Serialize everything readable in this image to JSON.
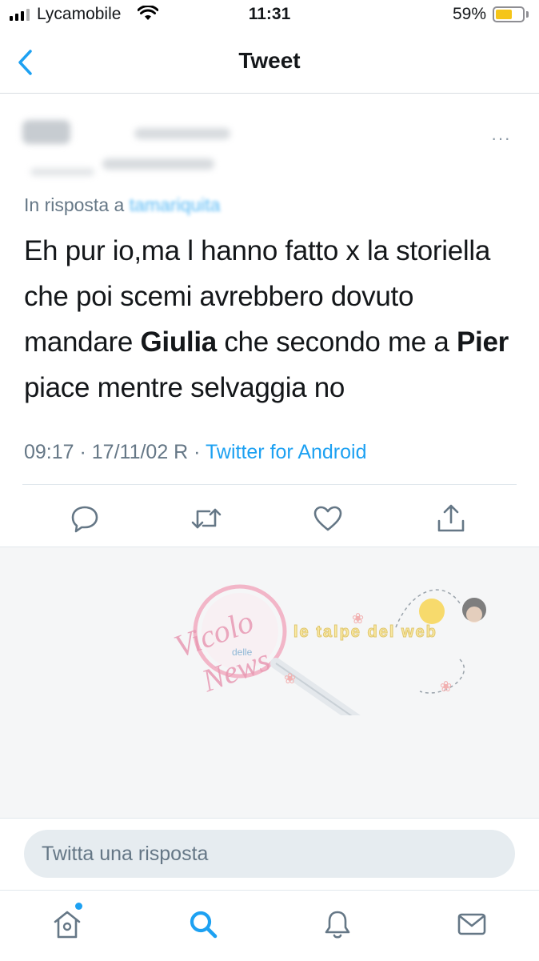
{
  "status_bar": {
    "carrier": "Lycamobile",
    "time": "11:31",
    "battery_percent": "59%",
    "battery_level": 0.59,
    "signal_bars": 4
  },
  "nav": {
    "title": "Tweet",
    "back_icon": "chevron-left-icon"
  },
  "tweet": {
    "more_label": "···",
    "reply_prefix": "In risposta a",
    "reply_handle": "tamariquita",
    "text_segments": [
      {
        "text": "Eh pur io,ma l hanno fatto x la storiella che poi scemi avrebbero dovuto mandare ",
        "bold": false
      },
      {
        "text": "Giulia",
        "bold": true
      },
      {
        "text": " che secondo me a ",
        "bold": false
      },
      {
        "text": "Pier",
        "bold": true
      },
      {
        "text": " piace mentre selvaggia no",
        "bold": false
      }
    ],
    "meta_time": "09:17 · 17/11/02 R · ",
    "meta_source": "Twitter for Android",
    "actions": [
      "reply-icon",
      "retweet-icon",
      "like-icon",
      "share-icon"
    ]
  },
  "watermark": {
    "line1": "Vicolo",
    "line2": "delle",
    "line3": "News",
    "tagline": "le talpe del web"
  },
  "reply_box": {
    "placeholder": "Twitta una risposta"
  },
  "tabbar": {
    "items": [
      "home-icon",
      "search-icon",
      "notifications-icon",
      "messages-icon"
    ],
    "active": "search-icon"
  },
  "colors": {
    "accent": "#1da1f2",
    "text": "#14171a",
    "secondary": "#657786",
    "icon_grey": "#657786"
  }
}
